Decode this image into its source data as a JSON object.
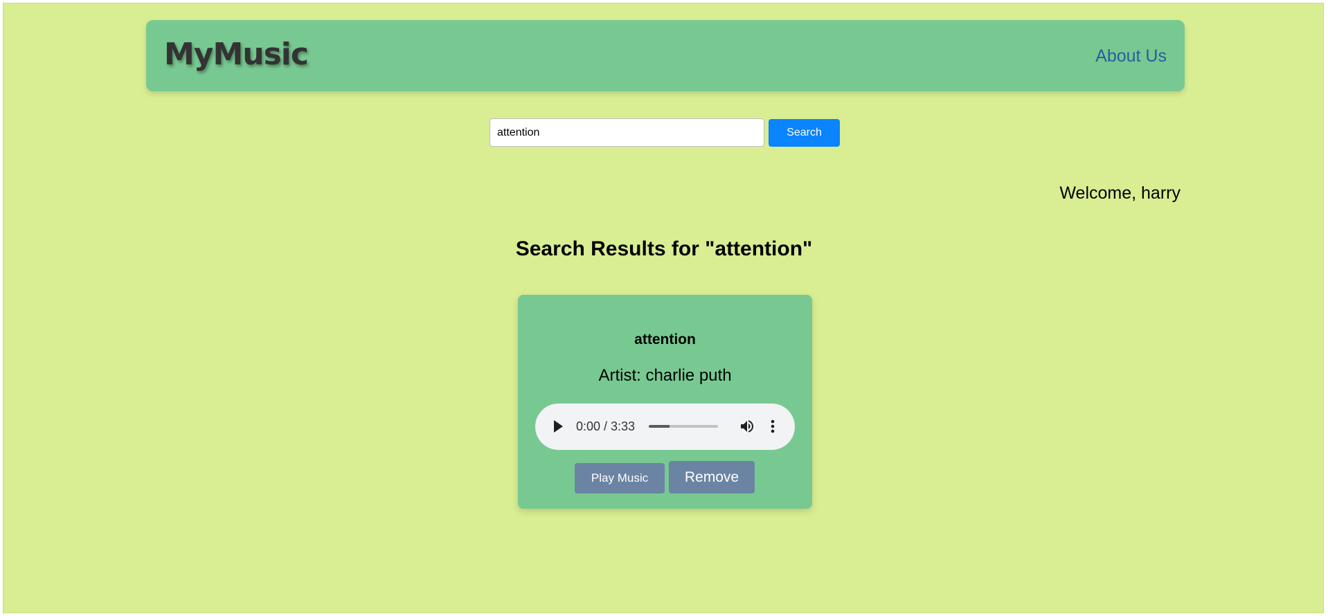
{
  "header": {
    "brand": "MyMusic",
    "about_link": "About Us"
  },
  "search": {
    "value": "attention",
    "placeholder": "",
    "button_label": "Search"
  },
  "welcome_text": "Welcome, harry",
  "results": {
    "heading": "Search Results for \"attention\"",
    "songs": [
      {
        "title": "attention",
        "artist": "Artist: charlie puth",
        "player": {
          "time": "0:00 / 3:33",
          "progress_percent": 30
        },
        "play_button_label": "Play Music",
        "remove_button_label": "Remove"
      }
    ]
  },
  "colors": {
    "page_background": "#d9ed93",
    "header_background": "#77c991",
    "card_background": "#77c991",
    "search_button": "#0a84ff",
    "action_button": "#6b84a3",
    "link": "#2a5c9c"
  },
  "icons": {
    "play": "play-icon",
    "volume": "volume-icon",
    "more": "more-options-icon"
  }
}
